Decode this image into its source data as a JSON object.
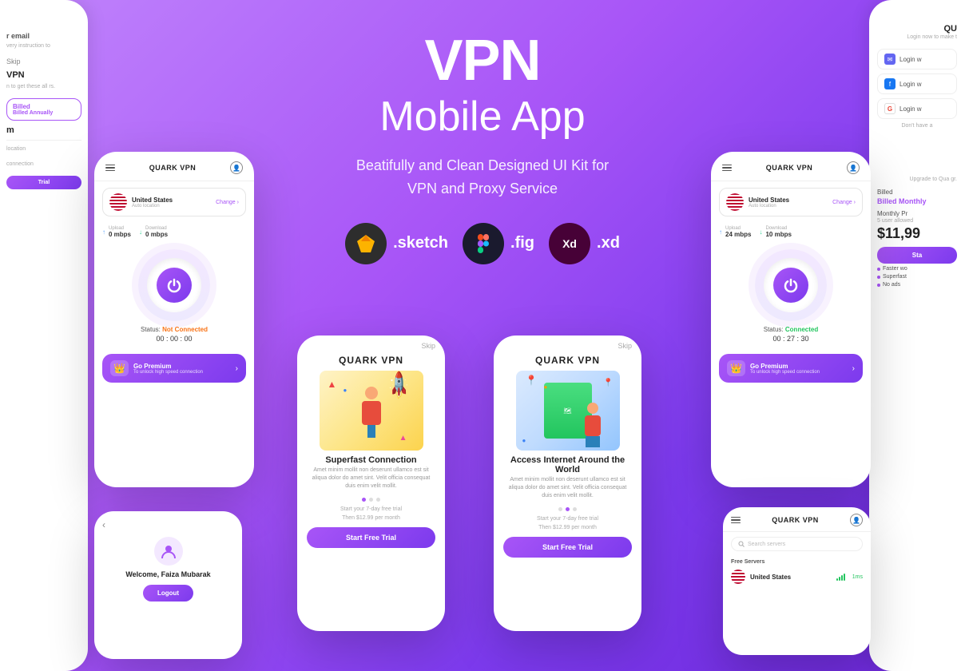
{
  "hero": {
    "title": "VPN",
    "subtitle": "Mobile App",
    "desc_line1": "Beatifully and Clean Designed UI Kit for",
    "desc_line2": "VPN and Proxy Service",
    "formats": [
      {
        "label": ".sketch",
        "icon": "◆",
        "bg_class": "badge-sketch"
      },
      {
        "label": ".fig",
        "icon": "◉",
        "bg_class": "badge-fig"
      },
      {
        "label": ".xd",
        "icon": "Xd",
        "bg_class": "badge-xd"
      }
    ]
  },
  "phone_left": {
    "header_title": "QUARK VPN",
    "location_name": "United States",
    "location_sub": "Auto location",
    "change_label": "Change",
    "upload_label": "Upload",
    "upload_val": "0 mbps",
    "download_label": "Download",
    "download_val": "0 mbps",
    "status_label": "Status:",
    "status_value": "Not Connected",
    "timer": "00 : 00 : 00",
    "premium_title": "Go Premium",
    "premium_sub": "To unlock high speed connection"
  },
  "phone_right": {
    "header_title": "QUARK VPN",
    "location_name": "United States",
    "location_sub": "Auto location",
    "change_label": "Change",
    "upload_label": "Upload",
    "upload_val": "24 mbps",
    "download_label": "Download",
    "download_val": "10 mbps",
    "status_label": "Status:",
    "status_value": "Connected",
    "timer": "00 : 27 : 30",
    "premium_title": "Go Premium",
    "premium_sub": "To unlock high speed connection"
  },
  "onboard1": {
    "skip": "Skip",
    "brand": "QUARK VPN",
    "title": "Superfast Connection",
    "desc": "Amet minim mollit non deserunt ullamco est sit aliqua dolor do amet sint. Velit officia consequat duis enim velit mollit.",
    "trial_line1": "Start your 7-day free trial",
    "trial_line2": "Then $12.99 per month",
    "start_btn": "Start Free Trial"
  },
  "onboard2": {
    "skip": "Skip",
    "brand": "QUARK VPN",
    "title": "Access Internet Around the World",
    "desc": "Amet minim mollit non deserunt ullamco est sit aliqua dolor do amet sint. Velit officia consequat duis enim velit mollit.",
    "trial_line1": "Start your 7-day free trial",
    "trial_line2": "Then $12.99 per month",
    "start_btn": "Start Free Trial"
  },
  "phone_bottom_left": {
    "back_label": "‹",
    "welcome_text": "Welcome, Faiza Mubarak",
    "logout_label": "Logout"
  },
  "phone_bottom_right": {
    "header_title": "QUARK VPN",
    "search_placeholder": "Search servers",
    "free_servers_label": "Free Servers",
    "server_name": "United States",
    "server_ping": "1ms"
  },
  "partial_left": {
    "email_label": "r email",
    "desc": "very instruction to",
    "skip_label": "Skip",
    "vpn_label": "VPN",
    "sub_label": "n to get these all rs.",
    "billed_label": "Billed Annually",
    "location_label": "location",
    "connection_label": "connection"
  },
  "partial_right": {
    "qu_title": "QU",
    "login_desc": "Login now to make t",
    "login_email": "Login w",
    "login_fb": "Login w",
    "login_g": "Login w",
    "dont_have": "Don't have a",
    "upgrade_desc": "Upgrade to Qua gr.",
    "billed_label": "Billed Monthly",
    "monthly_pr_label": "Monthly Pr",
    "users_label": "5 user allowed",
    "price": "$11,99",
    "start_label": "Sta",
    "feature1": "Faster wo",
    "feature2": "Superfast",
    "feature3": "No ads"
  }
}
